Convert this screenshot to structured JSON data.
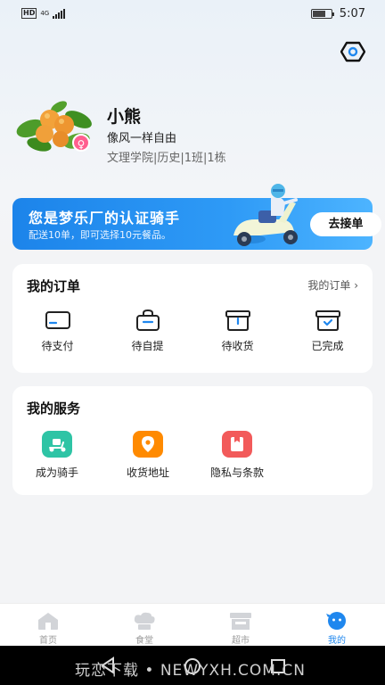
{
  "status_bar": {
    "network": "4G",
    "time": "5:07",
    "hd": "HD"
  },
  "profile": {
    "name": "小熊",
    "motto": "像风一样自由",
    "class_info": "文理学院|历史|1班|1栋",
    "gender_symbol": "♀"
  },
  "banner": {
    "title": "您是梦乐厂的认证骑手",
    "subtitle": "配送10单，即可选择10元餐品。",
    "button": "去接单"
  },
  "orders": {
    "title": "我的订单",
    "link": "我的订单 ›",
    "items": [
      {
        "label": "待支付",
        "icon": "card-icon"
      },
      {
        "label": "待自提",
        "icon": "bag-icon"
      },
      {
        "label": "待收货",
        "icon": "box-icon"
      },
      {
        "label": "已完成",
        "icon": "box-check-icon"
      }
    ]
  },
  "services": {
    "title": "我的服务",
    "items": [
      {
        "label": "成为骑手",
        "icon": "scooter-icon",
        "color": "#2ec4a5"
      },
      {
        "label": "收货地址",
        "icon": "location-icon",
        "color": "#ff8a00"
      },
      {
        "label": "隐私与条款",
        "icon": "privacy-icon",
        "color": "#f25a5a"
      }
    ]
  },
  "nav": {
    "items": [
      {
        "label": "首页",
        "icon": "home-icon"
      },
      {
        "label": "食堂",
        "icon": "chef-hat-icon"
      },
      {
        "label": "超市",
        "icon": "store-icon"
      },
      {
        "label": "我的",
        "icon": "profile-icon"
      }
    ],
    "active_index": 3,
    "active_color": "#1f87ee"
  },
  "watermark": "玩恋下载 • NEWYXH.COM.CN"
}
